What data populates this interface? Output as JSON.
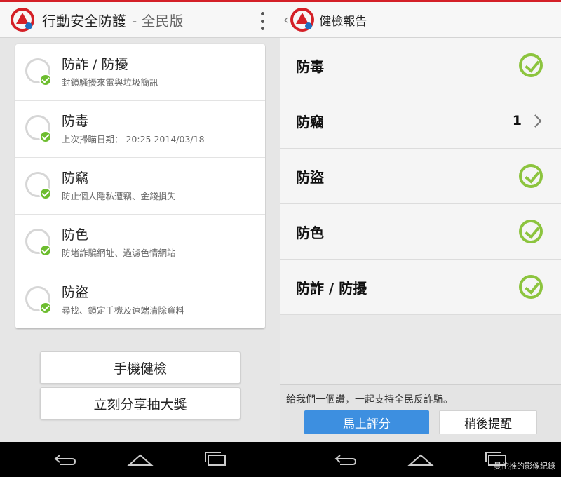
{
  "left_screen": {
    "app_title": "行動安全防護",
    "app_subtitle": "- 全民版",
    "features": [
      {
        "title": "防詐 / 防擾",
        "desc": "封鎖騷擾來電與垃圾簡訊",
        "icon": "phone-shield-icon"
      },
      {
        "title": "防毒",
        "desc": "上次掃瞄日期： 20:25 2014/03/18",
        "icon": "biohazard-icon"
      },
      {
        "title": "防竊",
        "desc": "防止個人隱私遭竊、金錢損失",
        "icon": "refresh-icon"
      },
      {
        "title": "防色",
        "desc": "防堵詐騙網址、過濾色情網站",
        "icon": "globe-icon"
      },
      {
        "title": "防盜",
        "desc": "尋找、鎖定手機及遠端清除資料",
        "icon": "phone-lock-icon"
      }
    ],
    "buttons": {
      "health_check": "手機健檢",
      "share_prize": "立刻分享抽大獎"
    }
  },
  "right_screen": {
    "back_glyph": "‹",
    "title": "健檢報告",
    "rows": [
      {
        "label": "防毒",
        "status": "check"
      },
      {
        "label": "防竊",
        "status": "count",
        "count": "1"
      },
      {
        "label": "防盜",
        "status": "check"
      },
      {
        "label": "防色",
        "status": "check"
      },
      {
        "label": "防詐 / 防擾",
        "status": "check"
      }
    ],
    "promo_text": "給我們一個讚，一起支持全民反詐騙。",
    "btn_rate": "馬上評分",
    "btn_later": "稍後提醒"
  },
  "watermark": "曼佗推的影像紀錄",
  "colors": {
    "brand_red": "#d42027",
    "check_green": "#8cc43e",
    "ok_green": "#6dbd2f",
    "rate_blue": "#3d8fe0"
  }
}
